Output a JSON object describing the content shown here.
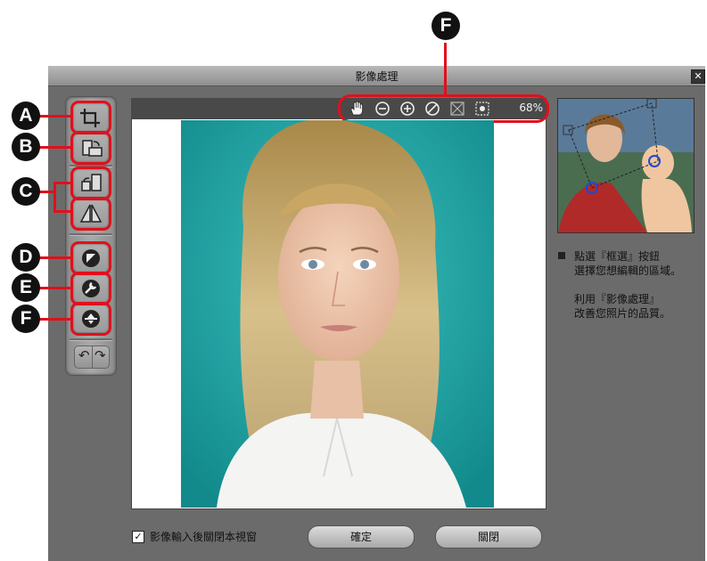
{
  "window": {
    "title": "影像處理",
    "close_label": "✕"
  },
  "callouts": {
    "a": "A",
    "b": "B",
    "c": "C",
    "d": "D",
    "e": "E",
    "f_side": "F",
    "f_top": "F"
  },
  "toolbar": {
    "tools": [
      {
        "name": "crop-icon"
      },
      {
        "name": "rotate-icon"
      },
      {
        "name": "rotate-left-icon"
      },
      {
        "name": "flip-icon"
      },
      {
        "name": "contrast-icon"
      },
      {
        "name": "enhance-icon"
      },
      {
        "name": "exposure-icon"
      }
    ],
    "undo_label": "↶",
    "redo_label": "↷"
  },
  "canvas_toolbar": {
    "icons": [
      "hand-icon",
      "zoom-out-icon",
      "zoom-in-icon",
      "no-zoom-icon",
      "fit-icon",
      "actual-size-icon"
    ],
    "zoom": "68%"
  },
  "help": {
    "line1": "點選『框選』按鈕",
    "line2": "選擇您想編輯的區域。",
    "line3": "利用『影像處理』",
    "line4": "改善您照片的品質。"
  },
  "footer": {
    "checkbox_checked": true,
    "checkbox_label": "影像輸入後關閉本視窗",
    "ok_label": "確定",
    "close_label": "關閉"
  },
  "colors": {
    "callout_red": "#e0101c",
    "photo_background": "#1aa3a3"
  }
}
